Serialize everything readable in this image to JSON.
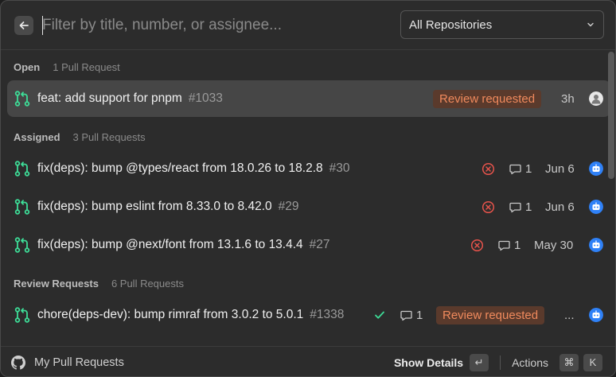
{
  "search": {
    "placeholder": "Filter by title, number, or assignee..."
  },
  "repo_filter": {
    "selected": "All Repositories"
  },
  "sections": [
    {
      "title": "Open",
      "count": "1 Pull Request",
      "items": [
        {
          "title": "feat: add support for pnpm",
          "number": "#1033",
          "badge": "Review requested",
          "time": "3h",
          "avatar": "user-avatar"
        }
      ]
    },
    {
      "title": "Assigned",
      "count": "3 Pull Requests",
      "items": [
        {
          "title": "fix(deps): bump @types/react from 18.0.26 to 18.2.8",
          "number": "#30",
          "comments": "1",
          "time": "Jun 6",
          "avatar": "bot-avatar"
        },
        {
          "title": "fix(deps): bump eslint from 8.33.0 to 8.42.0",
          "number": "#29",
          "comments": "1",
          "time": "Jun 6",
          "avatar": "bot-avatar"
        },
        {
          "title": "fix(deps): bump @next/font from 13.1.6 to 13.4.4",
          "number": "#27",
          "comments": "1",
          "time": "May 30",
          "avatar": "bot-avatar"
        }
      ]
    },
    {
      "title": "Review Requests",
      "count": "6 Pull Requests",
      "items": [
        {
          "title": "chore(deps-dev): bump rimraf from 3.0.2 to 5.0.1",
          "number": "#1338",
          "comments": "1",
          "badge": "Review requested",
          "time": "...",
          "avatar": "bot-avatar"
        }
      ]
    }
  ],
  "footer": {
    "app_name": "My Pull Requests",
    "primary_action": "Show Details",
    "primary_key": "↵",
    "actions_label": "Actions",
    "actions_key_1": "⌘",
    "actions_key_2": "K"
  },
  "colors": {
    "pr_icon": "#3ddc97",
    "fail": "#e5534b",
    "success": "#3ddc97",
    "badge_text": "#f08a5d",
    "badge_bg": "#5a3a2c",
    "bot": "#2f81f7"
  }
}
